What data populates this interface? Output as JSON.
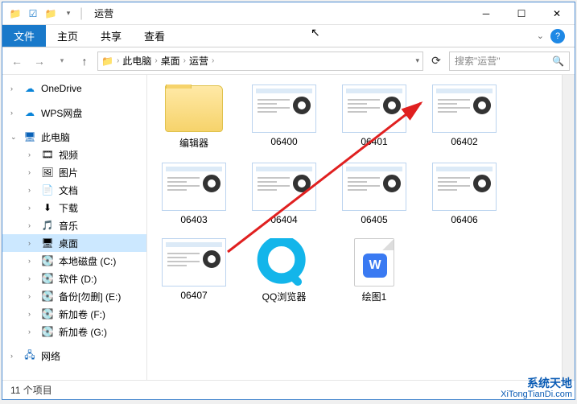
{
  "titlebar": {
    "title": "运营"
  },
  "ribbon": {
    "file": "文件",
    "tabs": [
      "主页",
      "共享",
      "查看"
    ]
  },
  "nav": {
    "breadcrumb": [
      "此电脑",
      "桌面",
      "运营"
    ],
    "search_placeholder": "搜索\"运营\""
  },
  "tree": {
    "onedrive": "OneDrive",
    "wps": "WPS网盘",
    "thispc": "此电脑",
    "children": [
      {
        "icon": "🎞",
        "label": "视频"
      },
      {
        "icon": "🖼",
        "label": "图片"
      },
      {
        "icon": "📄",
        "label": "文档"
      },
      {
        "icon": "⬇",
        "label": "下载"
      },
      {
        "icon": "🎵",
        "label": "音乐"
      },
      {
        "icon": "🖥",
        "label": "桌面",
        "selected": true
      },
      {
        "icon": "💽",
        "label": "本地磁盘 (C:)"
      },
      {
        "icon": "💽",
        "label": "软件 (D:)"
      },
      {
        "icon": "💽",
        "label": "备份[勿删] (E:)"
      },
      {
        "icon": "💽",
        "label": "新加卷 (F:)"
      },
      {
        "icon": "💽",
        "label": "新加卷 (G:)"
      }
    ],
    "network": "网络"
  },
  "items": [
    {
      "name": "编辑器",
      "type": "folder"
    },
    {
      "name": "06400",
      "type": "screenshot"
    },
    {
      "name": "06401",
      "type": "screenshot"
    },
    {
      "name": "06402",
      "type": "screenshot"
    },
    {
      "name": "06403",
      "type": "screenshot"
    },
    {
      "name": "06404",
      "type": "screenshot"
    },
    {
      "name": "06405",
      "type": "screenshot"
    },
    {
      "name": "06406",
      "type": "screenshot"
    },
    {
      "name": "06407",
      "type": "screenshot"
    },
    {
      "name": "QQ浏览器",
      "type": "qq"
    },
    {
      "name": "绘图1",
      "type": "wps"
    }
  ],
  "status": {
    "count_label": "11 个项目"
  },
  "watermark": {
    "line1": "系统天地",
    "line2": "XiTongTianDi.com"
  }
}
